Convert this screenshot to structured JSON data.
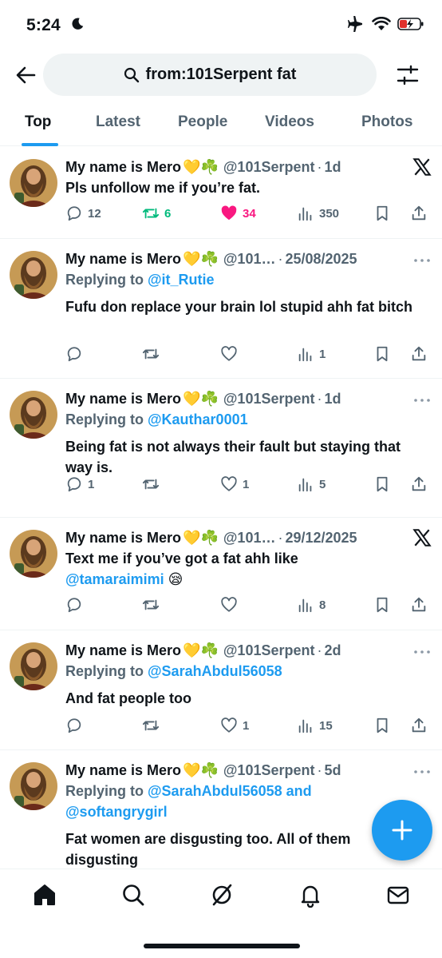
{
  "status_bar": {
    "time": "5:24"
  },
  "search": {
    "query": "from:101Serpent fat"
  },
  "tabs": [
    {
      "label": "Top"
    },
    {
      "label": "Latest"
    },
    {
      "label": "People"
    },
    {
      "label": "Videos"
    },
    {
      "label": "Photos"
    }
  ],
  "author": {
    "name": "My name is Mero",
    "emoji": "💛☘️"
  },
  "tweets": [
    {
      "handle": "@101Serpent",
      "time": "1d",
      "reply_prefix": "",
      "reply_to": "",
      "reply_to_2": "",
      "text": "Pls unfollow me if you’re fat.",
      "text_mention": "",
      "text_tail": "",
      "replies": "12",
      "retweets": "6",
      "likes": "34",
      "views": "350"
    },
    {
      "handle": "@101…",
      "time": "25/08/2025",
      "reply_prefix": "Replying to ",
      "reply_to": "@it_Rutie",
      "reply_to_2": "",
      "text": "Fufu don replace your brain lol stupid ahh fat bitch",
      "text_mention": "",
      "text_tail": "",
      "replies": "",
      "retweets": "",
      "likes": "",
      "views": "1"
    },
    {
      "handle": "@101Serpent",
      "time": "1d",
      "reply_prefix": "Replying to ",
      "reply_to": "@Kauthar0001",
      "reply_to_2": "",
      "text": "Being fat is not always their fault but staying that way is.",
      "text_mention": "",
      "text_tail": "",
      "replies": "1",
      "retweets": "",
      "likes": "1",
      "views": "5"
    },
    {
      "handle": "@101…",
      "time": "29/12/2025",
      "reply_prefix": "",
      "reply_to": "",
      "reply_to_2": "",
      "text": "Text me if you’ve got a fat ahh like ",
      "text_mention": "@tamaraimimi",
      "text_tail": " 😪",
      "replies": "",
      "retweets": "",
      "likes": "",
      "views": "8"
    },
    {
      "handle": "@101Serpent",
      "time": "2d",
      "reply_prefix": "Replying to ",
      "reply_to": "@SarahAbdul56058",
      "reply_to_2": "",
      "text": "And fat people too",
      "text_mention": "",
      "text_tail": "",
      "replies": "",
      "retweets": "",
      "likes": "1",
      "views": "15"
    },
    {
      "handle": "@101Serpent",
      "time": "5d",
      "reply_prefix": "Replying to ",
      "reply_to": "@SarahAbdul56058 and",
      "reply_to_2": "@softangrygirl",
      "text": "Fat women are disgusting too. All of them disgusting",
      "text_mention": "",
      "text_tail": "",
      "replies": "",
      "retweets": "",
      "likes": "",
      "views": ""
    }
  ],
  "colors": {
    "accent": "#1d9bf0",
    "retweet": "#00ba7c",
    "like": "#f91880",
    "muted": "#536471",
    "text": "#0f1419"
  }
}
